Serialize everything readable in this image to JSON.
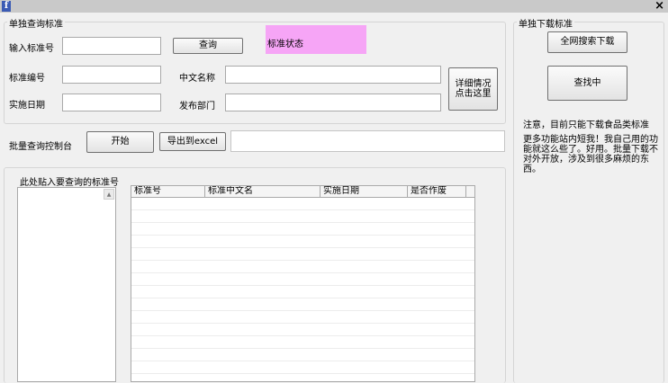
{
  "window": {
    "close_glyph": "×",
    "app_icon_glyph": "f"
  },
  "single_query": {
    "group_title": "单独查询标准",
    "input_std_no_label": "输入标准号",
    "input_std_no_value": "",
    "query_button": "查询",
    "status_label": "标准状态",
    "std_no_label": "标准编号",
    "std_no_value": "",
    "cn_name_label": "中文名称",
    "cn_name_value": "",
    "impl_date_label": "实施日期",
    "impl_date_value": "",
    "publisher_label": "发布部门",
    "publisher_value": "",
    "details_button": "详细情况\n点击这里"
  },
  "batch": {
    "console_label": "批量查询控制台",
    "start_button": "开始",
    "export_button": "导出到excel",
    "status_value": "",
    "group_title": "此处贴入要查询的标准号",
    "grid_columns": [
      "标准号",
      "标准中文名",
      "实施日期",
      "是否作废"
    ]
  },
  "download": {
    "group_title": "单独下载标准",
    "web_search_button": "全网搜索下载",
    "searching_button": "查找中",
    "note_line1": "注意，目前只能下载食品类标准",
    "note_line2": "更多功能站内短我！我自己用的功能就这么些了。好用。批量下载不对外开放，涉及到很多麻烦的东西。"
  },
  "colors": {
    "status_highlight": "#f6a5f6",
    "window_bg": "#f0f0f0"
  }
}
